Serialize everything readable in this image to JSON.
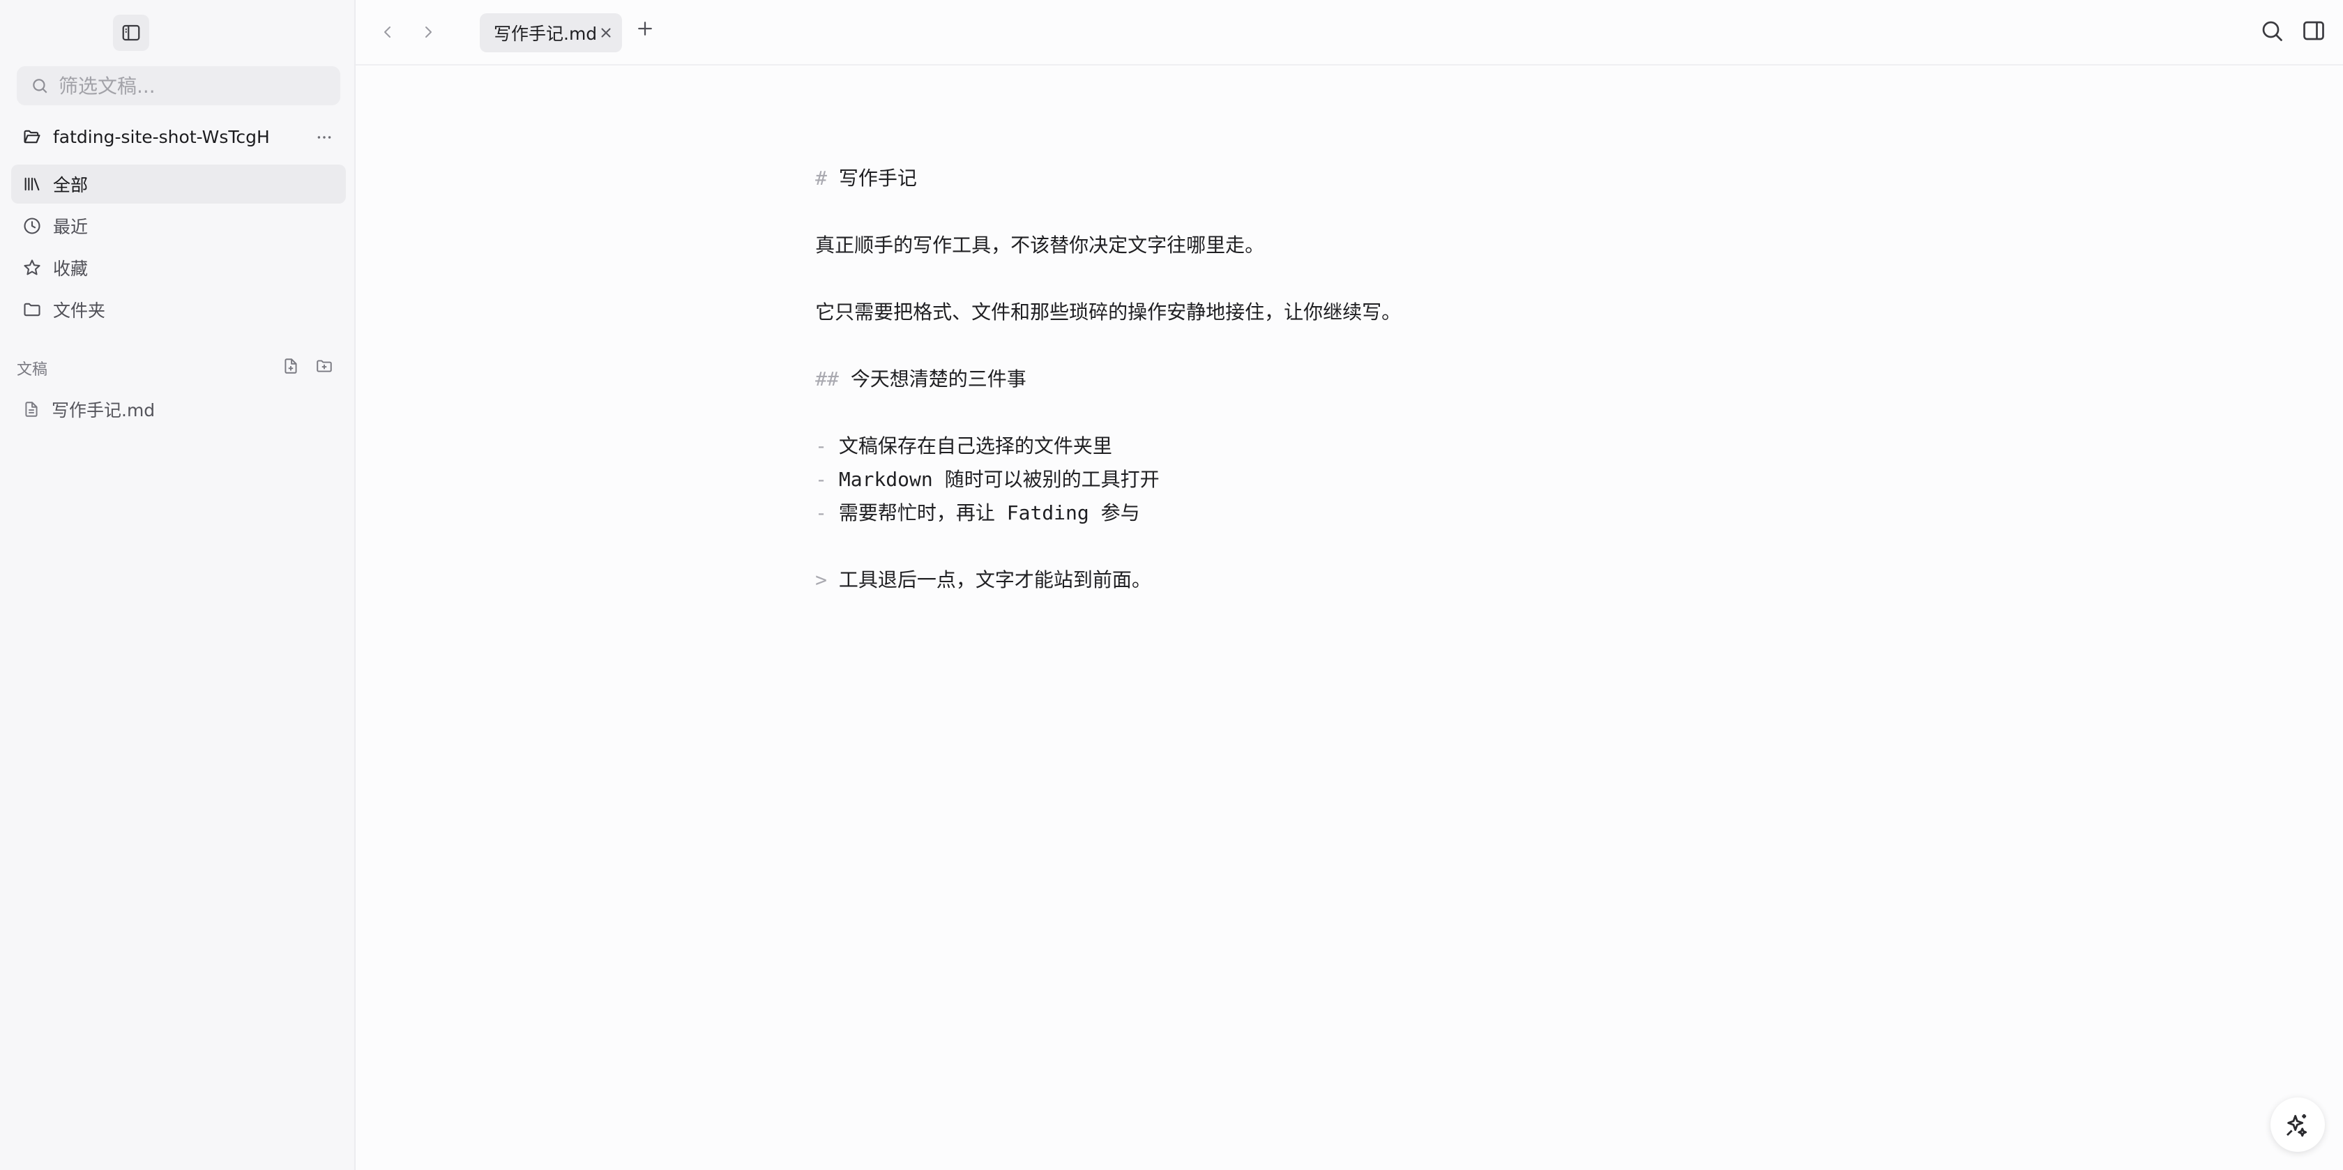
{
  "sidebar": {
    "search": {
      "placeholder": "筛选文稿..."
    },
    "workspace": {
      "name": "fatding-site-shot-WsTcgH"
    },
    "nav": [
      {
        "label": "全部",
        "icon": "library-icon",
        "active": true
      },
      {
        "label": "最近",
        "icon": "clock-icon",
        "active": false
      },
      {
        "label": "收藏",
        "icon": "star-icon",
        "active": false
      },
      {
        "label": "文件夹",
        "icon": "folder-icon",
        "active": false
      }
    ],
    "section": {
      "title": "文稿"
    },
    "files": [
      {
        "label": "写作手记.md",
        "icon": "document-icon"
      }
    ]
  },
  "tabs": [
    {
      "label": "写作手记.md",
      "active": true
    }
  ],
  "editor": {
    "lines": [
      {
        "mark": "#",
        "text": "写作手记"
      },
      {
        "mark": "",
        "text": "真正顺手的写作工具，不该替你决定文字往哪里走。"
      },
      {
        "mark": "",
        "text": "它只需要把格式、文件和那些琐碎的操作安静地接住，让你继续写。"
      },
      {
        "mark": "##",
        "text": "今天想清楚的三件事"
      },
      {
        "mark": "-",
        "text": "文稿保存在自己选择的文件夹里"
      },
      {
        "mark": "-",
        "text": "Markdown 随时可以被别的工具打开"
      },
      {
        "mark": "-",
        "text": "需要帮忙时，再让 Fatding 参与"
      },
      {
        "mark": ">",
        "text": "工具退后一点，文字才能站到前面。"
      }
    ]
  },
  "colors": {
    "sidebar_bg": "#f7f7f9",
    "active_bg": "#ebebee",
    "markdown_marker": "#a9a9b0",
    "text": "#1f1f22"
  }
}
